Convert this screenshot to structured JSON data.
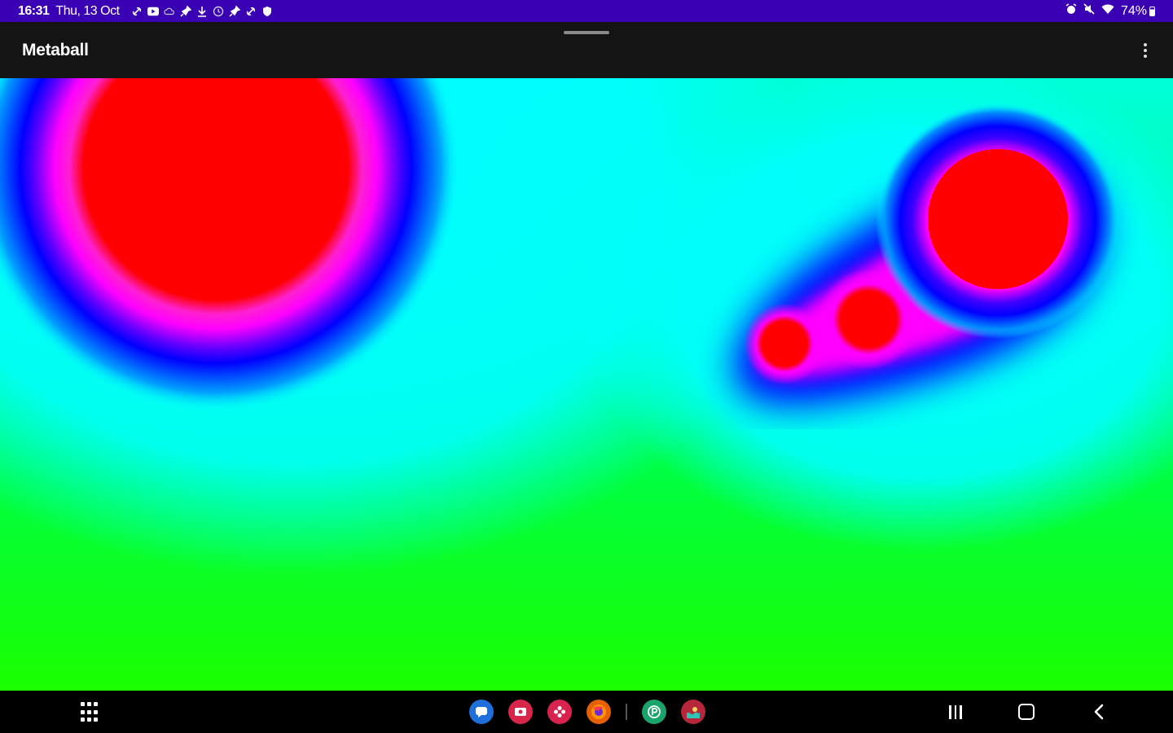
{
  "status_bar": {
    "time": "16:31",
    "date": "Thu, 13 Oct",
    "battery_percent": "74%",
    "notification_icons": [
      "link-icon",
      "youtube-icon",
      "cloud-icon",
      "pin-icon",
      "download-icon",
      "clock-icon",
      "pin-icon",
      "link-icon",
      "shield-icon"
    ],
    "system_icons": [
      "alarm-icon",
      "mute-icon",
      "wifi-icon",
      "battery-icon"
    ],
    "background_color": "#3a00b4"
  },
  "app_bar": {
    "title": "Metaball",
    "menu_icon": "overflow-menu-icon",
    "background_color": "#141414"
  },
  "canvas": {
    "description_colors": {
      "core": "#ff0000",
      "ring_inner": "#ff00ff",
      "ring_mid": "#0000ff",
      "ring_outer": "#00ffff",
      "field": "#00ff00"
    }
  },
  "nav_bar": {
    "apps_icon": "app-drawer-icon",
    "dock_apps": [
      {
        "name": "messages-icon",
        "color": "#1e6fd9",
        "glyph": "▪"
      },
      {
        "name": "screen-recorder-icon",
        "color": "#d8264a",
        "glyph": "▣"
      },
      {
        "name": "flower-app-icon",
        "color": "#d9234f",
        "glyph": "✿"
      },
      {
        "name": "firefox-icon",
        "color": "#e66000",
        "glyph": "◉"
      },
      {
        "name": "p-app-icon",
        "color": "#1aa36b",
        "glyph": "P"
      },
      {
        "name": "wave-app-icon",
        "color": "#b7273b",
        "glyph": "≈"
      }
    ],
    "recents_icon": "recents-icon",
    "home_icon": "home-icon",
    "back_icon": "back-icon"
  }
}
